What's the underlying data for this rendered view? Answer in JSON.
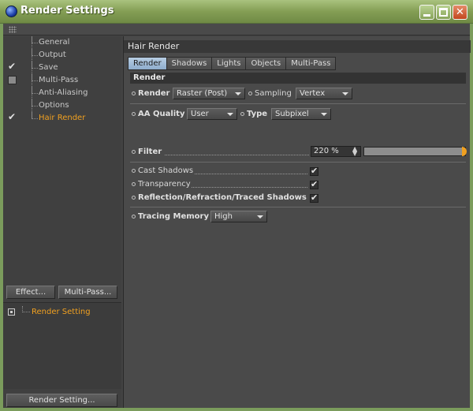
{
  "window": {
    "title": "Render Settings"
  },
  "left_panel": {
    "tree": [
      {
        "label": "General",
        "checked": false,
        "has_box": false,
        "active": false
      },
      {
        "label": "Output",
        "checked": false,
        "has_box": false,
        "active": false
      },
      {
        "label": "Save",
        "checked": true,
        "has_box": false,
        "active": false
      },
      {
        "label": "Multi-Pass",
        "checked": false,
        "has_box": true,
        "active": false
      },
      {
        "label": "Anti-Aliasing",
        "checked": false,
        "has_box": false,
        "active": false
      },
      {
        "label": "Options",
        "checked": false,
        "has_box": false,
        "active": false
      },
      {
        "label": "Hair Render",
        "checked": true,
        "has_box": false,
        "active": true
      }
    ],
    "effect_button": "Effect...",
    "multipass_button": "Multi-Pass...",
    "list_item": "Render Setting",
    "render_setting_button": "Render Setting..."
  },
  "right_panel": {
    "header": "Hair Render",
    "tabs": [
      "Render",
      "Shadows",
      "Lights",
      "Objects",
      "Multi-Pass"
    ],
    "active_tab": "Render",
    "section": "Render",
    "render_label": "Render",
    "render_value": "Raster (Post)",
    "sampling_label": "Sampling",
    "sampling_value": "Vertex",
    "aa_label": "AA Quality",
    "aa_value": "User",
    "type_label": "Type",
    "type_value": "Subpixel",
    "filter_label": "Filter",
    "filter_value": "220 %",
    "filter_slider_fraction": 1.0,
    "cast_shadows_label": "Cast Shadows",
    "transparency_label": "Transparency",
    "reflection_label": "Reflection/Refraction/Traced Shadows",
    "tracing_memory_label": "Tracing Memory",
    "tracing_memory_value": "High"
  },
  "colors": {
    "accent_orange": "#f0a020",
    "active_tab": "#9db9d6",
    "title_green": "#849e54"
  }
}
